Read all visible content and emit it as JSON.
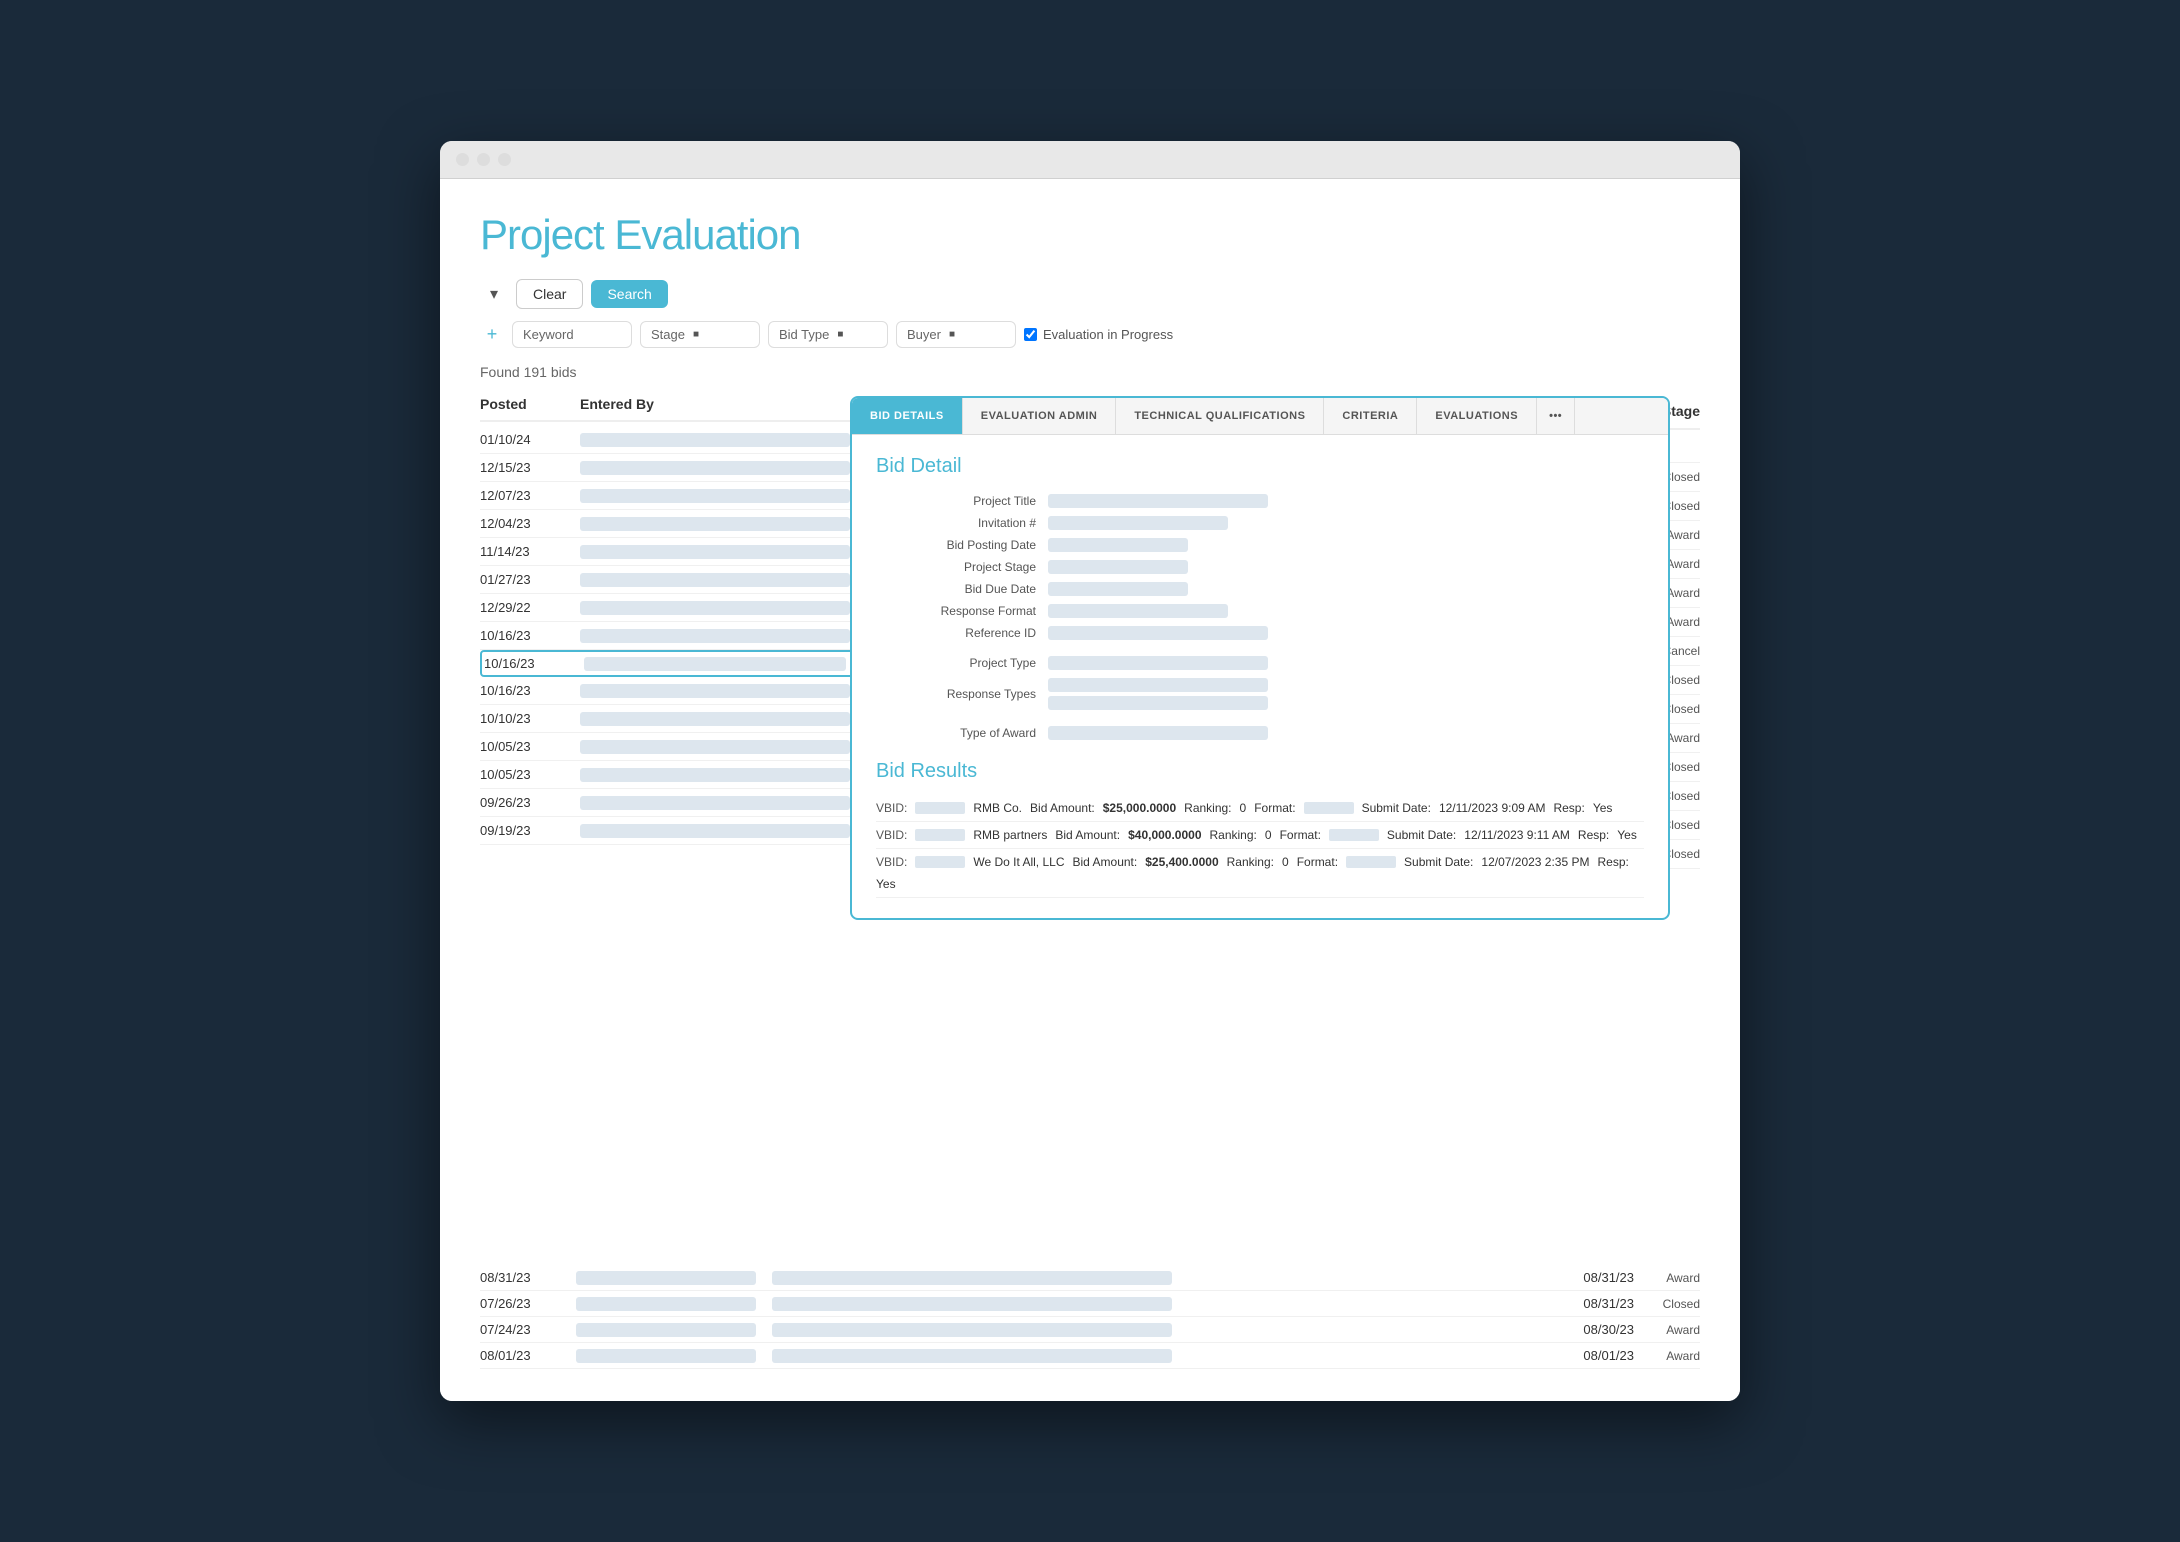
{
  "window": {
    "title": "Project Evaluation"
  },
  "header": {
    "title": "Project Evaluation",
    "clear_label": "Clear",
    "search_label": "Search",
    "found_text": "Found 191 bids"
  },
  "filters": {
    "keyword_placeholder": "Keyword",
    "stage_label": "Stage",
    "bid_type_label": "Bid Type",
    "buyer_label": "Buyer",
    "eval_in_progress": "Evaluation in Progress"
  },
  "list": {
    "col_posted": "Posted",
    "col_entered_by": "Entered By",
    "col_stage": "Stage",
    "rows": [
      {
        "date": "01/10/24",
        "stage": ""
      },
      {
        "date": "12/15/23",
        "stage": "Closed"
      },
      {
        "date": "12/07/23",
        "stage": "Closed"
      },
      {
        "date": "12/04/23",
        "stage": "Award"
      },
      {
        "date": "11/14/23",
        "stage": "Award"
      },
      {
        "date": "01/27/23",
        "stage": "Award"
      },
      {
        "date": "12/29/22",
        "stage": "Award"
      },
      {
        "date": "10/16/23",
        "stage": "Cancel"
      },
      {
        "date": "10/16/23",
        "stage": "Closed",
        "selected": true
      },
      {
        "date": "10/16/23",
        "stage": "Closed"
      },
      {
        "date": "10/10/23",
        "stage": "Award"
      },
      {
        "date": "10/05/23",
        "stage": "Closed"
      },
      {
        "date": "10/05/23",
        "stage": "Closed"
      },
      {
        "date": "09/26/23",
        "stage": "Closed"
      },
      {
        "date": "09/19/23",
        "stage": "Closed"
      }
    ]
  },
  "detail": {
    "tabs": [
      {
        "label": "BID DETAILS",
        "active": true
      },
      {
        "label": "EVALUATION ADMIN",
        "active": false
      },
      {
        "label": "TECHNICAL QUALIFICATIONS",
        "active": false
      },
      {
        "label": "CRITERIA",
        "active": false
      },
      {
        "label": "EVALUATIONS",
        "active": false
      },
      {
        "label": "...",
        "active": false
      }
    ],
    "bid_detail_title": "Bid Detail",
    "fields": [
      {
        "label": "Project Title"
      },
      {
        "label": "Invitation #"
      },
      {
        "label": "Bid Posting Date"
      },
      {
        "label": "Project Stage"
      },
      {
        "label": "Bid Due Date"
      },
      {
        "label": "Response Format"
      },
      {
        "label": "Reference ID"
      },
      {
        "label": ""
      },
      {
        "label": "Project Type"
      },
      {
        "label": "Response Types"
      },
      {
        "label": ""
      },
      {
        "label": "Type of Award"
      }
    ],
    "bid_results_title": "Bid Results",
    "results": [
      {
        "vbid": "VBID:",
        "company": "RMB Co.",
        "bid_amount_label": "Bid Amount:",
        "bid_amount": "$25,000.0000",
        "ranking_label": "Ranking:",
        "ranking": "0",
        "format_label": "Format:",
        "submit_date_label": "Submit Date:",
        "submit_date": "12/11/2023 9:09 AM",
        "resp_label": "Resp:",
        "resp": "Yes"
      },
      {
        "vbid": "VBID:",
        "company": "RMB partners",
        "bid_amount_label": "Bid Amount:",
        "bid_amount": "$40,000.0000",
        "ranking_label": "Ranking:",
        "ranking": "0",
        "format_label": "Format:",
        "submit_date_label": "Submit Date:",
        "submit_date": "12/11/2023 9:11 AM",
        "resp_label": "Resp:",
        "resp": "Yes"
      },
      {
        "vbid": "VBID:",
        "company": "We Do It All, LLC",
        "bid_amount_label": "Bid Amount:",
        "bid_amount": "$25,400.0000",
        "ranking_label": "Ranking:",
        "ranking": "0",
        "format_label": "Format:",
        "submit_date_label": "Submit Date:",
        "submit_date": "12/07/2023 2:35 PM",
        "resp_label": "Resp:",
        "resp": "Yes"
      }
    ]
  },
  "below_rows": [
    {
      "left_date": "08/31/23",
      "right_date": "08/31/23",
      "stage": "Award"
    },
    {
      "left_date": "07/26/23",
      "right_date": "08/31/23",
      "stage": "Closed"
    },
    {
      "left_date": "07/24/23",
      "right_date": "08/30/23",
      "stage": "Award"
    },
    {
      "left_date": "08/01/23",
      "right_date": "08/01/23",
      "stage": "Award"
    }
  ]
}
